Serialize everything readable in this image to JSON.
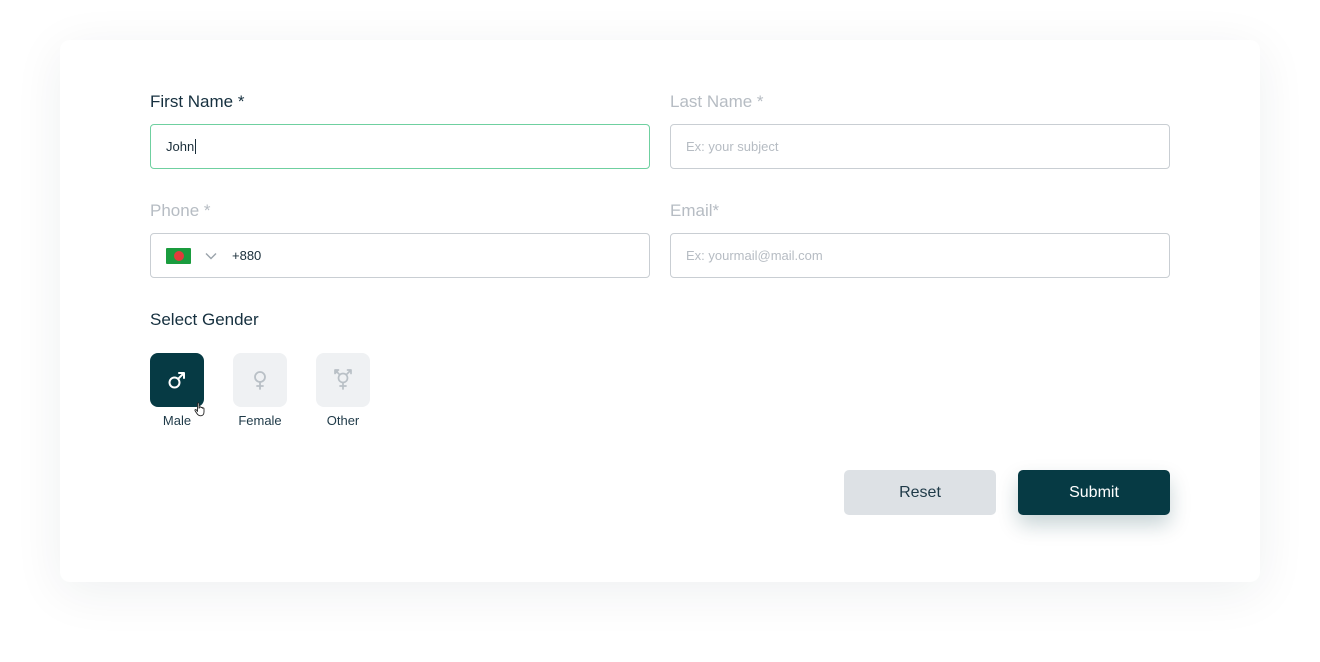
{
  "form": {
    "first_name": {
      "label": "First Name *",
      "value": "John",
      "placeholder": ""
    },
    "last_name": {
      "label": "Last Name *",
      "value": "",
      "placeholder": "Ex: your subject"
    },
    "phone": {
      "label": "Phone *",
      "value": "+880",
      "country_flag": "bangladesh-flag-icon"
    },
    "email": {
      "label": "Email*",
      "value": "",
      "placeholder": "Ex: yourmail@mail.com"
    },
    "gender": {
      "label": "Select Gender",
      "selected": "Male",
      "options": [
        {
          "label": "Male",
          "icon": "male-icon"
        },
        {
          "label": "Female",
          "icon": "female-icon"
        },
        {
          "label": "Other",
          "icon": "transgender-icon"
        }
      ]
    },
    "buttons": {
      "reset": "Reset",
      "submit": "Submit"
    }
  },
  "colors": {
    "primary": "#063a44",
    "focus_border": "#6fd0a0",
    "muted_label": "#b6bcc3",
    "reset_bg": "#dde1e5"
  }
}
